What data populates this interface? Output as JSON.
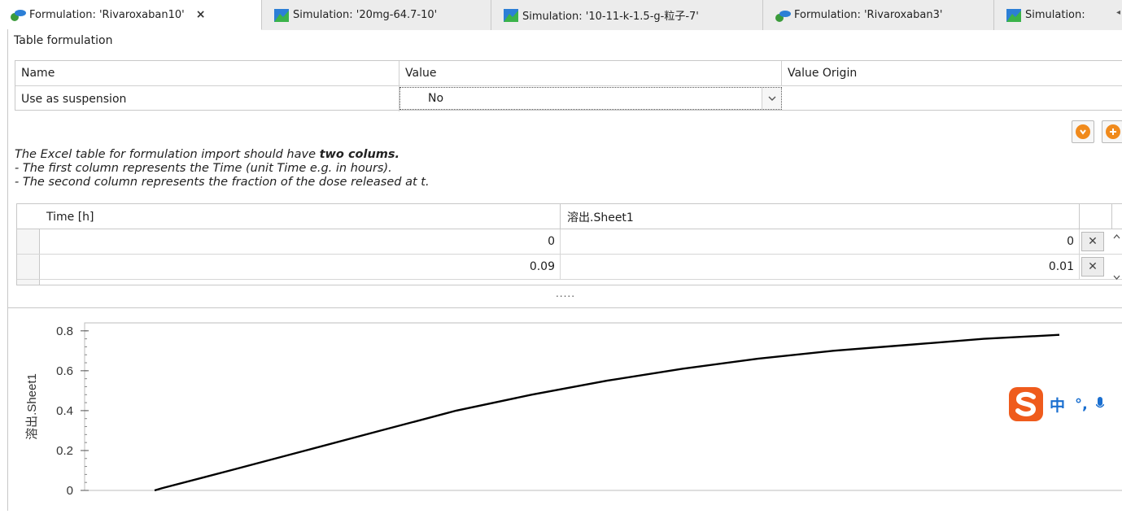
{
  "tabs": [
    {
      "label": "Formulation: 'Rivaroxaban10'",
      "type": "formulation",
      "active": true,
      "closable": true
    },
    {
      "label": "Simulation: '20mg-64.7-10'",
      "type": "simulation"
    },
    {
      "label": "Simulation: '10-11-k-1.5-g-粒子-7'",
      "type": "simulation"
    },
    {
      "label": "Formulation: 'Rivaroxaban3'",
      "type": "formulation"
    },
    {
      "label": "Simulation:",
      "type": "simulation"
    }
  ],
  "tab_close_glyph": "×",
  "section_title": "Table formulation",
  "parameter_grid": {
    "headers": {
      "name": "Name",
      "value": "Value",
      "origin": "Value Origin"
    },
    "row": {
      "name": "Use as suspension",
      "value": "No",
      "origin": ""
    }
  },
  "description": {
    "line1_prefix": "The Excel table for formulation import should have ",
    "line1_bold": "two colums",
    "line1_suffix": ".",
    "line2": " -  The first column represents the Time (unit Time e.g. in hours).",
    "line3": " -  The second column represents the fraction of the dose released at t."
  },
  "table": {
    "columns": [
      "Time [h]",
      "溶出.Sheet1"
    ],
    "rows": [
      {
        "time": "0",
        "value": "0"
      },
      {
        "time": "0.09",
        "value": "0.01"
      }
    ],
    "delete_glyph": "✕"
  },
  "splitter_glyph": ".....",
  "chart_data": {
    "type": "line",
    "ylabel": "溶出.Sheet1",
    "yticks": [
      "0.8",
      "0.6",
      "0.4",
      "0.2",
      "0"
    ],
    "ylim": [
      0,
      0.84
    ],
    "grid": false,
    "series": [
      {
        "x": [
          0,
          0.09,
          1,
          2,
          3,
          4,
          5,
          6,
          7,
          8,
          9,
          10,
          11,
          12
        ],
        "values": [
          0,
          0.01,
          0.1,
          0.2,
          0.3,
          0.4,
          0.48,
          0.55,
          0.61,
          0.66,
          0.7,
          0.73,
          0.76,
          0.78
        ],
        "color": "#000000"
      }
    ]
  },
  "ime": {
    "mode": "中",
    "punct": "°,"
  },
  "colors": {
    "accent_orange": "#f08a1c",
    "ime_blue": "#1a6fd0",
    "sogou_orange": "#ef5b1c"
  }
}
